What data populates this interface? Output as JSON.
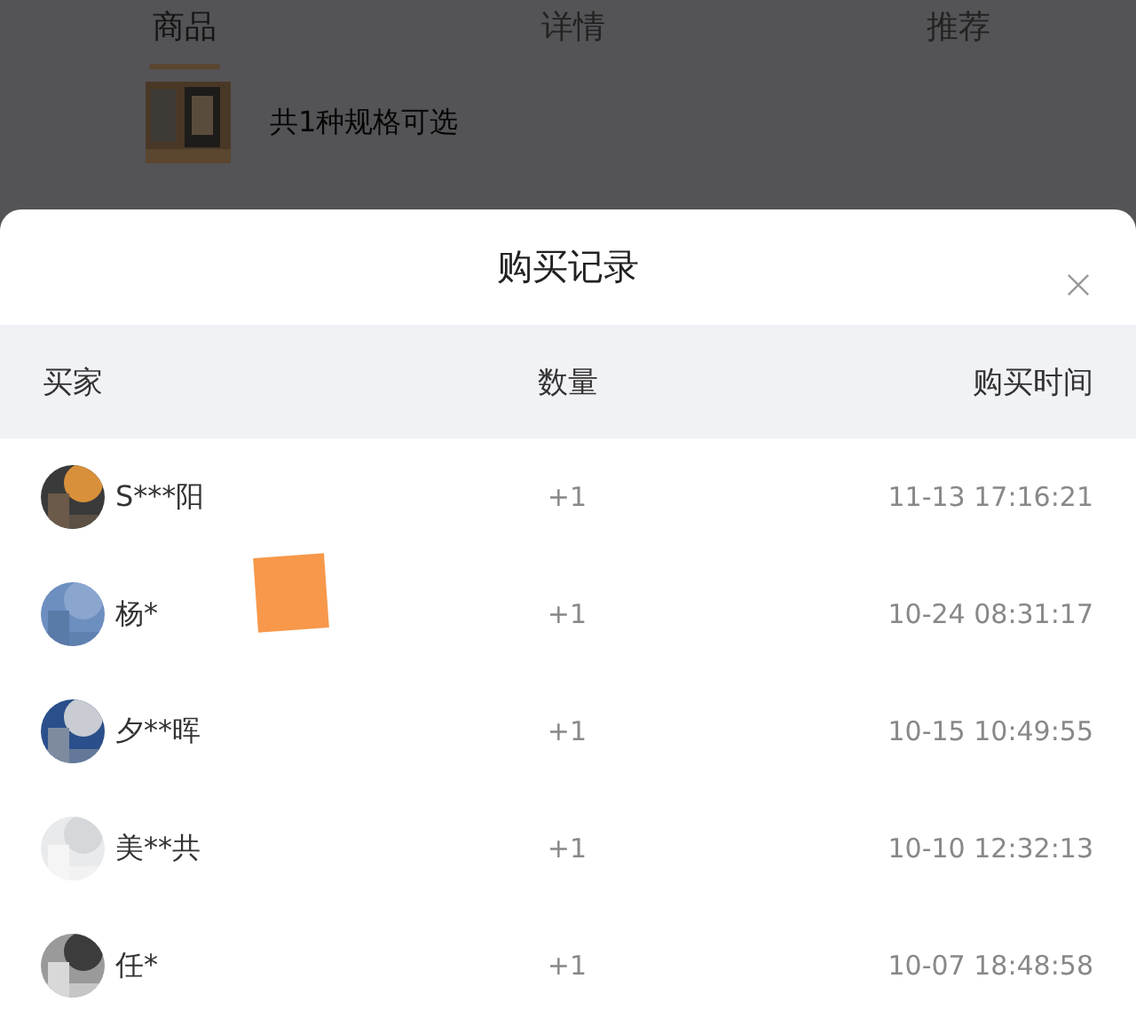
{
  "tabs": [
    {
      "label": "商品",
      "selected": true
    },
    {
      "label": "详情",
      "selected": false
    },
    {
      "label": "推荐",
      "selected": false
    }
  ],
  "product": {
    "spec_text": "共1种规格可选"
  },
  "sheet": {
    "title": "购买记录",
    "columns": [
      "买家",
      "数量",
      "购买时间"
    ],
    "rows": [
      {
        "buyer": "S***阳",
        "quantity": "+1",
        "time": "11-13 17:16:21"
      },
      {
        "buyer": "杨*",
        "quantity": "+1",
        "time": "10-24 08:31:17"
      },
      {
        "buyer": "夕**晖",
        "quantity": "+1",
        "time": "10-15 10:49:55"
      },
      {
        "buyer": "美**共",
        "quantity": "+1",
        "time": "10-10 12:32:13"
      },
      {
        "buyer": "任*",
        "quantity": "+1",
        "time": "10-07 18:48:58"
      }
    ]
  }
}
